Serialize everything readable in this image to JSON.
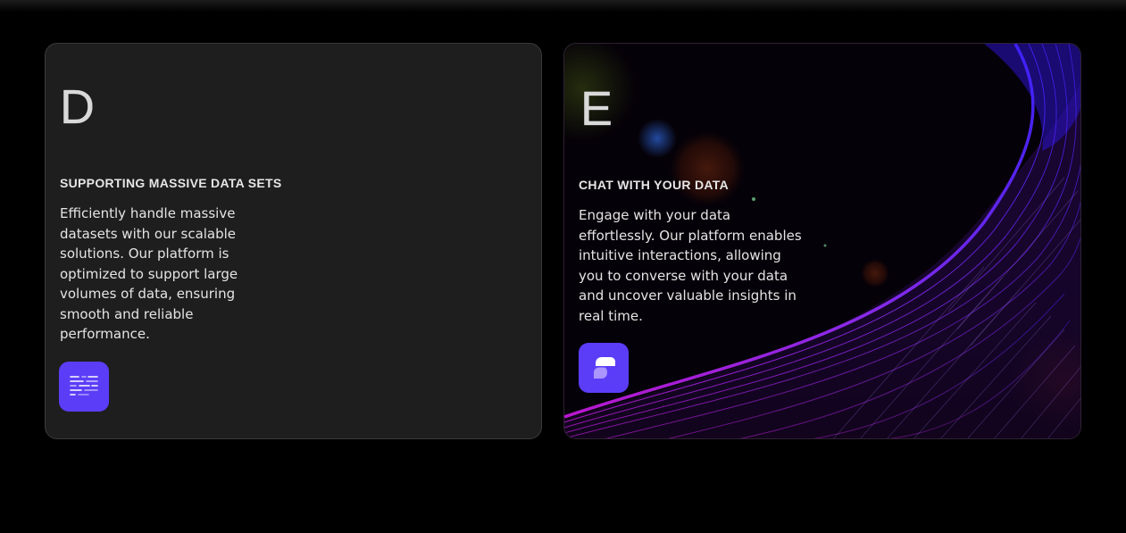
{
  "cards": [
    {
      "letter": "D",
      "title": "SUPPORTING MASSIVE DATA SETS",
      "description": "Efficiently handle massive datasets with our scalable solutions. Our platform is optimized to support large volumes of data, ensuring smooth and reliable performance.",
      "icon": "data-lines-icon"
    },
    {
      "letter": "E",
      "title": "CHAT WITH YOUR DATA",
      "description": "Engage with your data effortlessly. Our platform enables intuitive interactions, allowing you to converse with your data and uncover valuable insights in real time.",
      "icon": "chat-bubbles-icon"
    }
  ],
  "colors": {
    "page_background": "#000000",
    "card_background": "#1e1e1e",
    "accent": "#5b3df8",
    "wave_purple": "#9b2cf0",
    "wave_blue": "#4a2cff"
  }
}
